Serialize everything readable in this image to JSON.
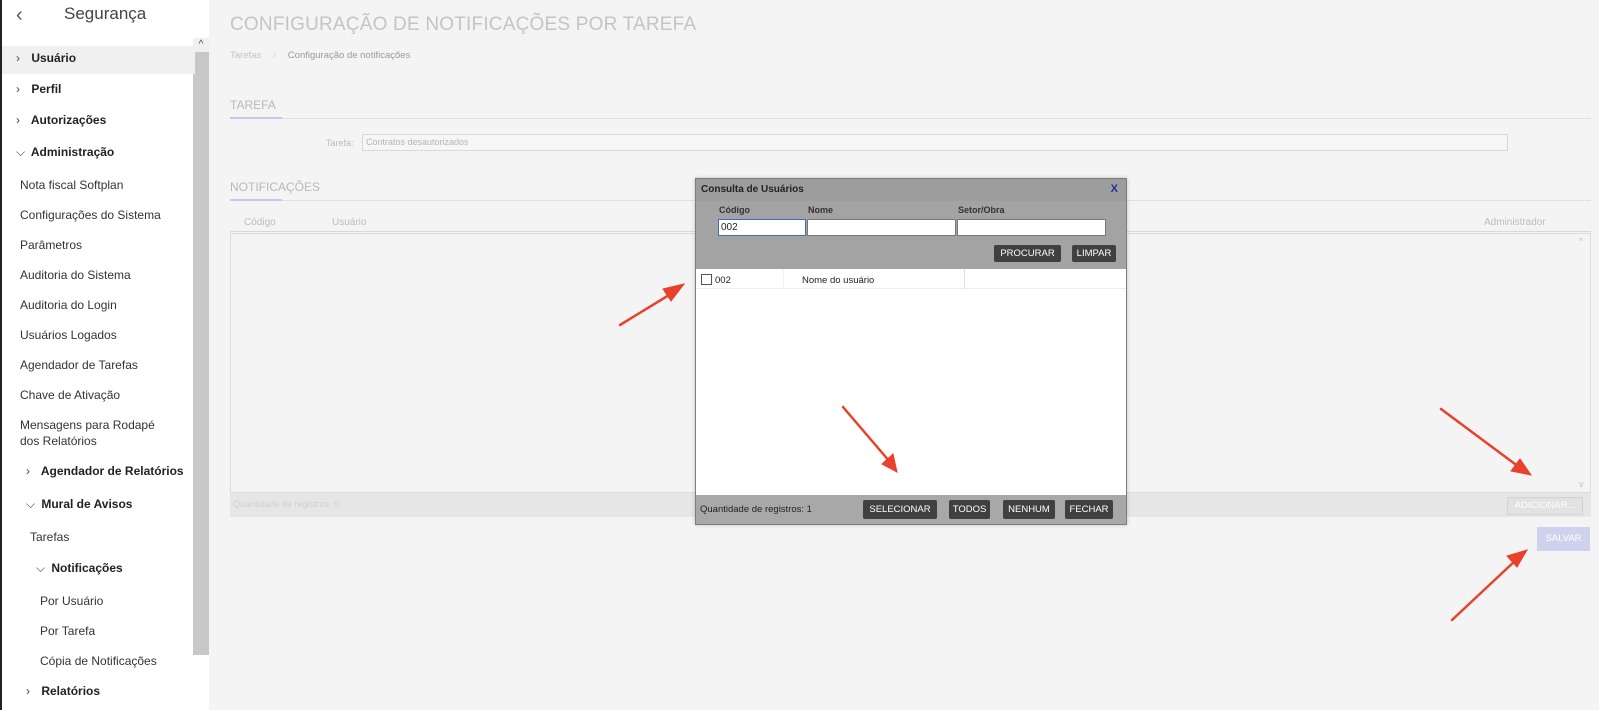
{
  "sidebar": {
    "title": "Segurança",
    "items": [
      {
        "label": "Usuário",
        "chevron": ">"
      },
      {
        "label": "Perfil",
        "chevron": ">"
      },
      {
        "label": "Autorizações",
        "chevron": ">"
      },
      {
        "label": "Administração",
        "chevron": "v"
      },
      {
        "label": "Nota fiscal Softplan"
      },
      {
        "label": "Configurações do Sistema"
      },
      {
        "label": "Parâmetros"
      },
      {
        "label": "Auditoria do Sistema"
      },
      {
        "label": "Auditoria do Login"
      },
      {
        "label": "Usuários Logados"
      },
      {
        "label": "Agendador de Tarefas"
      },
      {
        "label": "Chave de Ativação"
      },
      {
        "label": "Mensagens para Rodapé"
      },
      {
        "label": "dos Relatórios"
      },
      {
        "label": "Agendador de Relatórios",
        "chevron": ">"
      },
      {
        "label": "Mural de Avisos",
        "chevron": "v"
      },
      {
        "label": "Tarefas"
      },
      {
        "label": "Notificações",
        "chevron": "v"
      },
      {
        "label": "Por Usuário"
      },
      {
        "label": "Por Tarefa"
      },
      {
        "label": "Cópia de Notificações"
      },
      {
        "label": "Relatórios",
        "chevron": ">"
      }
    ]
  },
  "main": {
    "title": "CONFIGURAÇÃO DE NOTIFICAÇÕES POR TAREFA",
    "breadcrumb": [
      "Tarefas",
      "/",
      "Configuração de notificações"
    ],
    "tarefa_section": "TAREFA",
    "tarefa_label": "Tarefa:",
    "tarefa_value": "Contratos desautorizados",
    "notificacoes_section": "NOTIFICAÇÕES",
    "grid_headers": {
      "codigo": "Código",
      "usuario": "Usuário",
      "administrador": "Administrador"
    },
    "grid_footer": "Quantidade de registros: 0",
    "add_button": "ADICIONAR...",
    "save_button": "SALVAR",
    "scroll_up": "^",
    "scroll_down": "v"
  },
  "modal": {
    "title": "Consulta de Usuários",
    "close": "X",
    "columns": {
      "codigo": "Código",
      "nome": "Nome",
      "setor": "Setor/Obra"
    },
    "codigo_value": "002",
    "nome_value": "",
    "setor_value": "",
    "search_button": "PROCURAR",
    "clear_button": "LIMPAR",
    "rows": [
      {
        "codigo": "002",
        "nome": "Nome do usuário",
        "checked": false
      }
    ],
    "count_text": "Quantidade de registros: 1",
    "select_button": "SELECIONAR",
    "all_button": "TODOS",
    "none_button": "NENHUM",
    "close_button": "FECHAR"
  },
  "colors": {
    "arrow": "#e8412c",
    "modal_header": "#9d9d9d",
    "button_dark": "#404040",
    "save_accent": "#cfd2ee"
  }
}
